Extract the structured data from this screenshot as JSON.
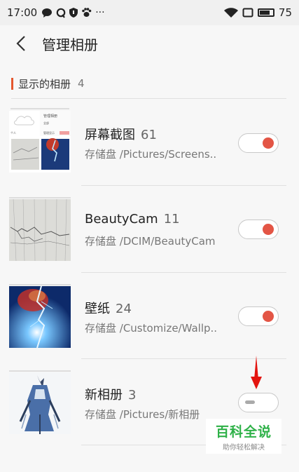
{
  "status_bar": {
    "time": "17:00",
    "more": "···",
    "battery_level": "75",
    "battery_fraction": 0.75
  },
  "header": {
    "title": "管理相册"
  },
  "section": {
    "label": "显示的相册",
    "count": "4"
  },
  "albums": [
    {
      "name": "屏幕截图",
      "count": "61",
      "path": "存储盘 /Pictures/Screens..",
      "enabled": true,
      "thumb_texts": [
        "管理相册",
        "全部",
        "个人",
        "管理显示"
      ]
    },
    {
      "name": "BeautyCam",
      "count": "11",
      "path": "存储盘 /DCIM/BeautyCam",
      "enabled": true
    },
    {
      "name": "壁纸",
      "count": "24",
      "path": "存储盘 /Customize/Wallp..",
      "enabled": true
    },
    {
      "name": "新相册",
      "count": "3",
      "path": "存储盘 /Pictures/新相册",
      "enabled": false
    }
  ],
  "watermark": {
    "title": "百科全说",
    "subtitle": "助你轻松解决"
  },
  "colors": {
    "accent": "#e35545",
    "section_bar": "#e4572e",
    "watermark_green": "#2eb148"
  }
}
